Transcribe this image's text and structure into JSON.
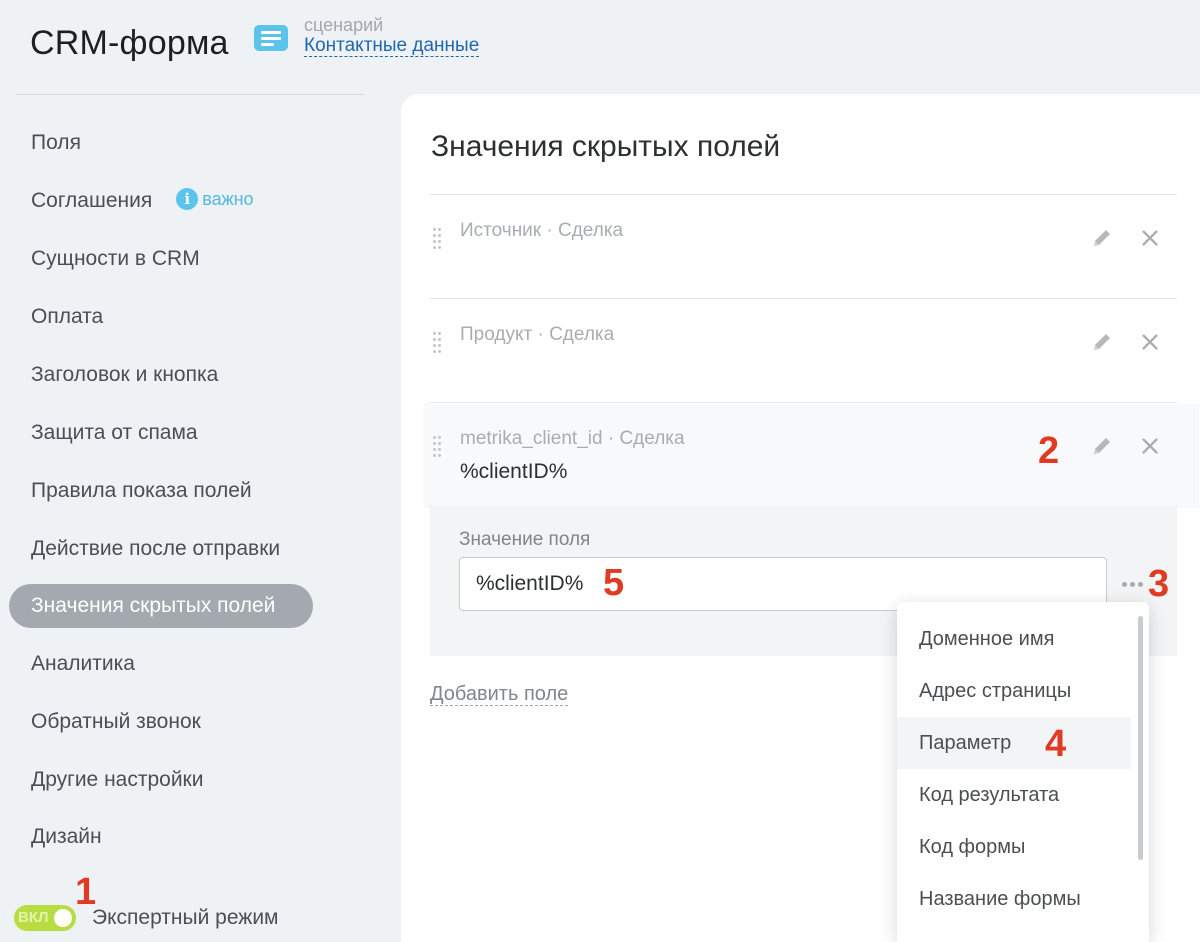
{
  "header": {
    "app_title": "CRM-форма",
    "scenario_label": "сценарий",
    "scenario_link": "Контактные данные",
    "scenario_icon": "document-lines-icon"
  },
  "sidebar": {
    "items": [
      {
        "label": "Поля"
      },
      {
        "label": "Соглашения",
        "badge": "важно"
      },
      {
        "label": "Сущности в CRM"
      },
      {
        "label": "Оплата"
      },
      {
        "label": "Заголовок и кнопка"
      },
      {
        "label": "Защита от спама"
      },
      {
        "label": "Правила показа полей"
      },
      {
        "label": "Действие после отправки"
      },
      {
        "label": "Значения скрытых полей",
        "active": true
      },
      {
        "label": "Аналитика"
      },
      {
        "label": "Обратный звонок"
      },
      {
        "label": "Другие настройки"
      },
      {
        "label": "Дизайн"
      }
    ],
    "badge_icon_glyph": "i",
    "expert_toggle": {
      "state_label": "ВКЛ",
      "label": "Экспертный режим",
      "on": true
    }
  },
  "panel": {
    "title": "Значения скрытых полей",
    "fields": [
      {
        "label": "Источник · Сделка",
        "value": ""
      },
      {
        "label": "Продукт · Сделка",
        "value": ""
      },
      {
        "label": "metrika_client_id · Сделка",
        "value": "%clientID%",
        "selected": true
      }
    ],
    "value_editor": {
      "label": "Значение поля",
      "value": "%clientID%"
    },
    "add_field_label": "Добавить поле"
  },
  "dropdown": {
    "items": [
      {
        "label": "Доменное имя"
      },
      {
        "label": "Адрес страницы"
      },
      {
        "label": "Параметр",
        "hover": true
      },
      {
        "label": "Код результата"
      },
      {
        "label": "Код формы"
      },
      {
        "label": "Название формы"
      }
    ]
  },
  "annotations": {
    "toggle": "1",
    "edit": "2",
    "dots": "3",
    "param": "4",
    "input": "5"
  },
  "colors": {
    "accent_blue": "#5cc3ec",
    "link_blue": "#2067b0",
    "toggle_green": "#b7dd43",
    "annotation_red": "#e03a22",
    "active_nav": "#a3a9ae"
  }
}
